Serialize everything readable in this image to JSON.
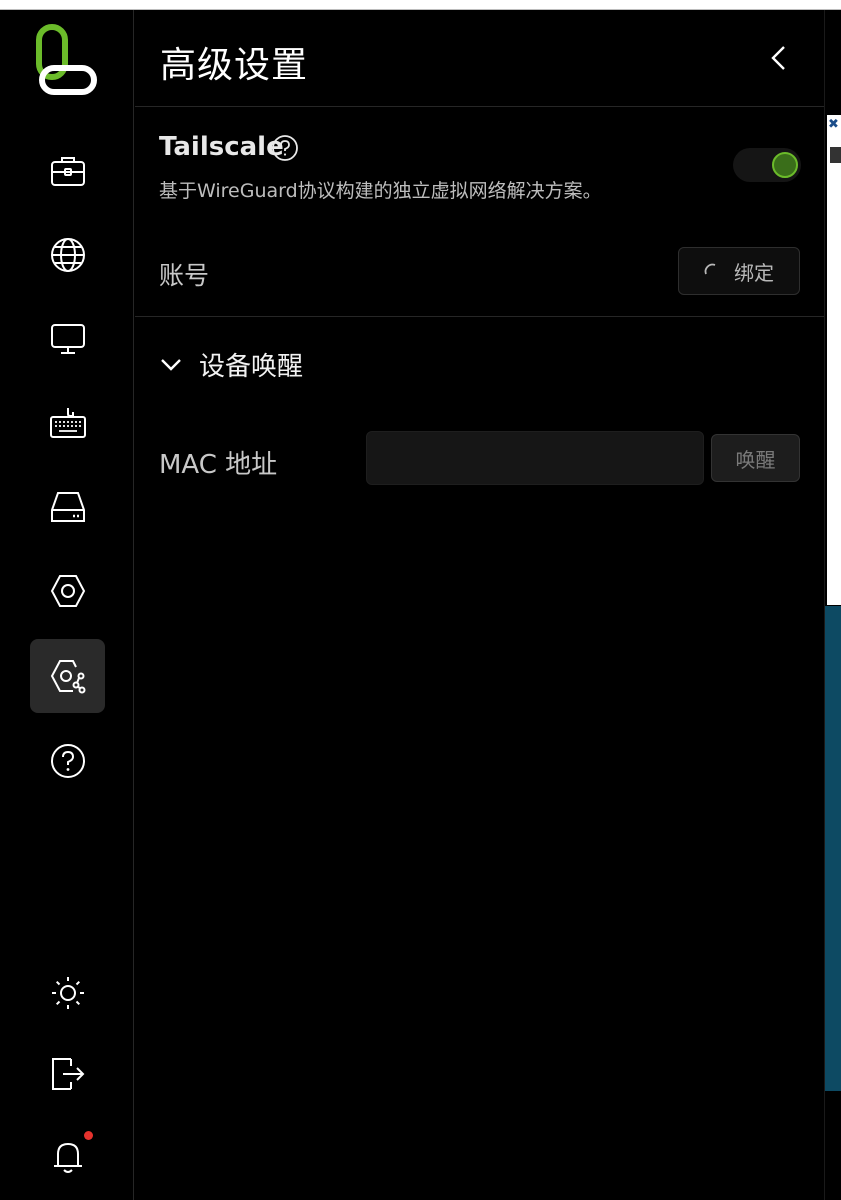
{
  "panel": {
    "title": "高级设置",
    "tailscale": {
      "title": "Tailscale",
      "description": "基于WireGuard协议构建的独立虚拟网络解决方案。",
      "enabled": true,
      "account_label": "账号",
      "bind_button": "绑定"
    },
    "wake": {
      "section_title": "设备唤醒",
      "mac_label": "MAC 地址",
      "mac_value": "",
      "wake_button": "唤醒"
    }
  },
  "sidebar": {
    "items": [
      {
        "icon": "toolbox-icon"
      },
      {
        "icon": "globe-icon"
      },
      {
        "icon": "monitor-icon"
      },
      {
        "icon": "keyboard-icon"
      },
      {
        "icon": "drive-icon"
      },
      {
        "icon": "hexagon-settings-icon"
      },
      {
        "icon": "advanced-settings-icon",
        "active": true
      },
      {
        "icon": "help-icon"
      }
    ],
    "bottom": [
      {
        "icon": "sun-icon"
      },
      {
        "icon": "logout-icon"
      },
      {
        "icon": "bell-icon",
        "has_notification": true
      }
    ]
  },
  "colors": {
    "accent_green": "#6bbb2a",
    "notification_red": "#e5322d"
  }
}
